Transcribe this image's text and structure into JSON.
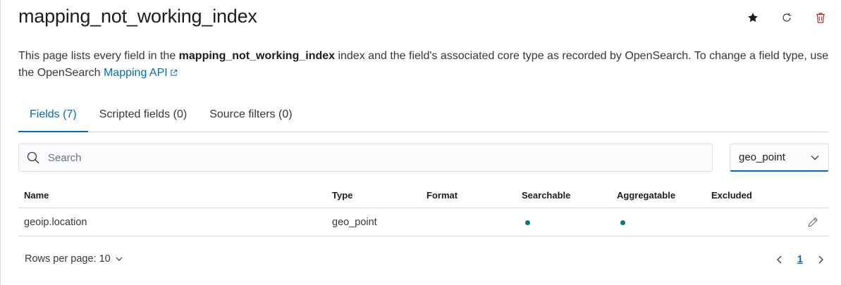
{
  "header": {
    "title": "mapping_not_working_index",
    "actions": [
      "star-icon",
      "refresh-icon",
      "trash-icon"
    ]
  },
  "description": {
    "before": "This page lists every field in the ",
    "index_name": "mapping_not_working_index",
    "after": " index and the field's associated core type as recorded by OpenSearch. To change a field type, use the OpenSearch ",
    "link": "Mapping API"
  },
  "tabs": [
    {
      "label": "Fields (7)",
      "active": true
    },
    {
      "label": "Scripted fields (0)",
      "active": false
    },
    {
      "label": "Source filters (0)",
      "active": false
    }
  ],
  "search": {
    "placeholder": "Search",
    "value": ""
  },
  "type_filter": {
    "selected": "geo_point"
  },
  "table": {
    "columns": [
      "Name",
      "Type",
      "Format",
      "Searchable",
      "Aggregatable",
      "Excluded"
    ],
    "rows": [
      {
        "name": "geoip.location",
        "type": "geo_point",
        "format": "",
        "searchable": true,
        "aggregatable": true,
        "excluded": false
      }
    ]
  },
  "footer": {
    "rows_per_page": "Rows per page: 10",
    "current_page": "1"
  },
  "colors": {
    "accent": "#006bb8",
    "success_dot": "#017d73",
    "danger": "#bd271e"
  }
}
